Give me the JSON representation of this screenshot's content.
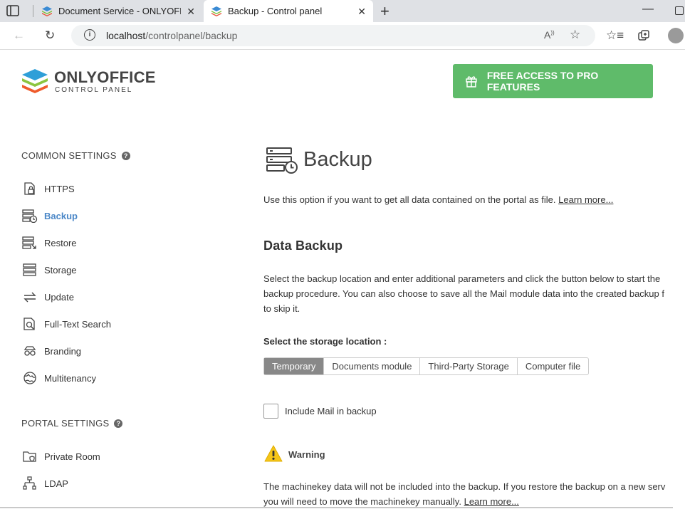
{
  "browser": {
    "tabs": [
      {
        "title": "Document Service - ONLYOFFICE",
        "active": false
      },
      {
        "title": "Backup - Control panel",
        "active": true
      }
    ],
    "url": {
      "host": "localhost",
      "path": "/controlpanel/backup"
    }
  },
  "header": {
    "logo_title": "ONLYOFFICE",
    "logo_subtitle": "CONTROL PANEL",
    "pro_button": "FREE ACCESS TO PRO FEATURES"
  },
  "sidebar": {
    "common_heading": "COMMON SETTINGS",
    "common_items": [
      {
        "label": "HTTPS",
        "icon": "lock-document-icon"
      },
      {
        "label": "Backup",
        "icon": "backup-icon",
        "active": true
      },
      {
        "label": "Restore",
        "icon": "restore-icon"
      },
      {
        "label": "Storage",
        "icon": "storage-icon"
      },
      {
        "label": "Update",
        "icon": "update-icon"
      },
      {
        "label": "Full-Text Search",
        "icon": "full-text-search-icon"
      },
      {
        "label": "Branding",
        "icon": "branding-icon"
      },
      {
        "label": "Multitenancy",
        "icon": "globe-icon"
      }
    ],
    "portal_heading": "PORTAL SETTINGS",
    "portal_items": [
      {
        "label": "Private Room",
        "icon": "private-room-icon"
      },
      {
        "label": "LDAP",
        "icon": "ldap-icon"
      }
    ]
  },
  "main": {
    "title": "Backup",
    "description": "Use this option if you want to get all data contained on the portal as file.",
    "learn_more": "Learn more...",
    "section_title": "Data Backup",
    "paragraph_lines": [
      "Select the backup location and enter additional parameters and click the button below to start the",
      "backup procedure. You can also choose to save all the Mail module data into the created backup f",
      "to skip it."
    ],
    "storage_label": "Select the storage location :",
    "storage_options": [
      "Temporary",
      "Documents module",
      "Third-Party Storage",
      "Computer file"
    ],
    "storage_selected": "Temporary",
    "include_mail_label": "Include Mail in backup",
    "include_mail_checked": false,
    "warning_title": "Warning",
    "warning_lines": [
      "The machinekey data will not be included into the backup. If you restore the backup on a new serv",
      "you will need to move the machinekey manually."
    ],
    "warning_learn_more": "Learn more..."
  },
  "colors": {
    "accent_green": "#5fbb6a",
    "active_link": "#4a87c7",
    "warning_yellow": "#f5c518"
  }
}
